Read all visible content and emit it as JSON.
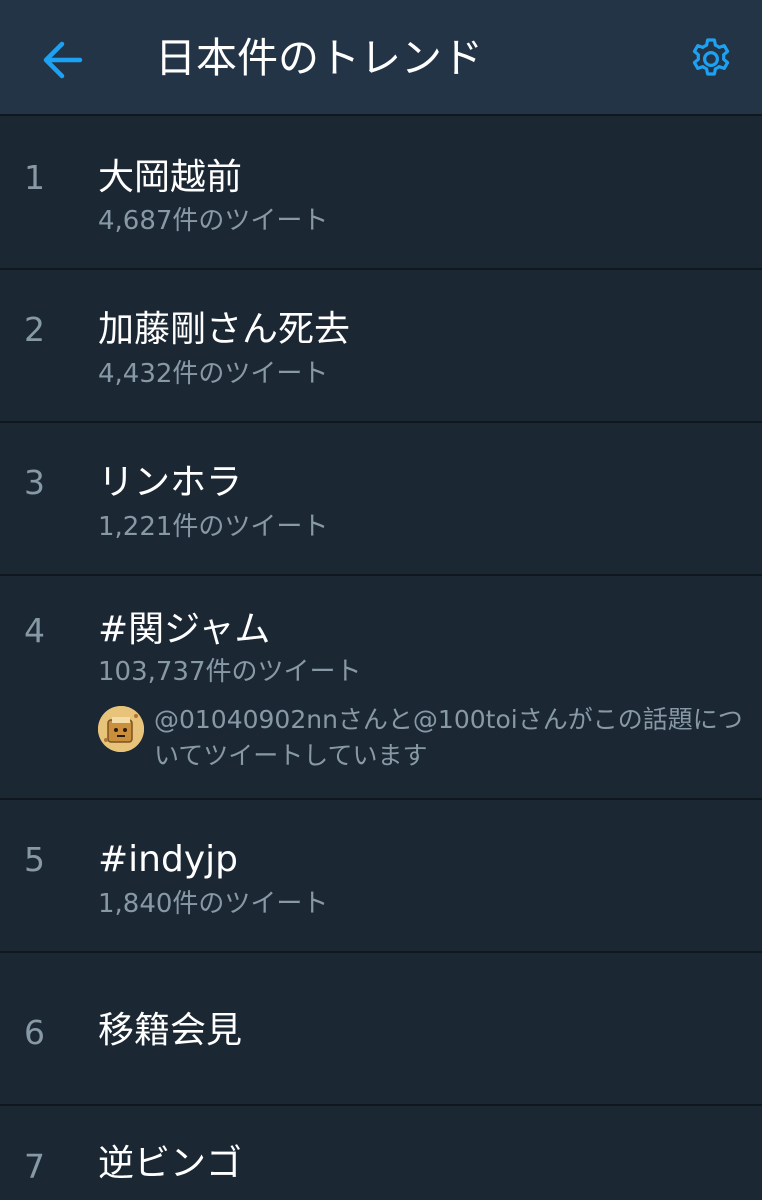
{
  "header": {
    "title": "日本件のトレンド",
    "back_icon": "arrow-left-icon",
    "settings_icon": "gear-icon",
    "accent_color": "#1da1f2"
  },
  "trends": [
    {
      "rank": "1",
      "name": "大岡越前",
      "count": "4,687件のツイート"
    },
    {
      "rank": "2",
      "name": "加藤剛さん死去",
      "count": "4,432件のツイート"
    },
    {
      "rank": "3",
      "name": "リンホラ",
      "count": "1,221件のツイート"
    },
    {
      "rank": "4",
      "name": "#関ジャム",
      "count": "103,737件のツイート",
      "context": "@01040902nnさんと@100toiさんがこの話題についてツイートしています"
    },
    {
      "rank": "5",
      "name": "#indyjp",
      "count": "1,840件のツイート"
    },
    {
      "rank": "6",
      "name": "移籍会見"
    },
    {
      "rank": "7",
      "name": "逆ビンゴ"
    }
  ]
}
